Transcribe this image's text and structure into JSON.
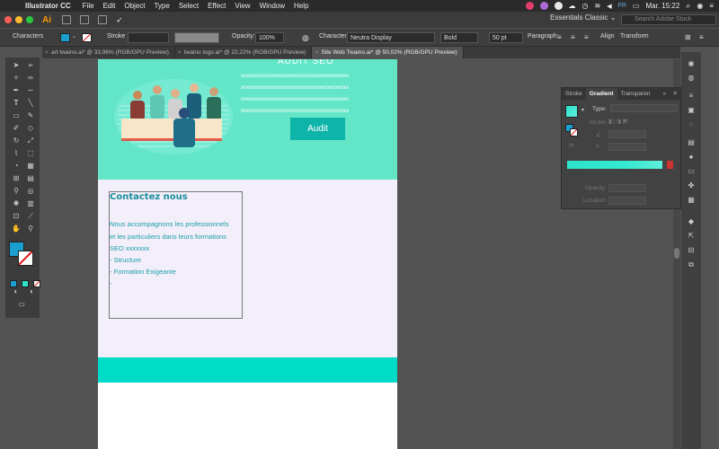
{
  "menubar": {
    "app": "Illustrator CC",
    "items": [
      "File",
      "Edit",
      "Object",
      "Type",
      "Select",
      "Effect",
      "View",
      "Window",
      "Help"
    ],
    "flag": "FR",
    "clock": "Mar. 15:22"
  },
  "appbar": {
    "logo": "Ai",
    "workspace": "Essentials Classic",
    "search_placeholder": "Search Adobe Stock"
  },
  "controlbar": {
    "characters": "Characters",
    "stroke": "Stroke",
    "opacity_label": "Opacity:",
    "opacity_value": "100%",
    "character_label": "Character:",
    "font": "Neutra Display",
    "weight": "Bold",
    "size": "50 pt",
    "paragraph": "Paragraph:",
    "align": "Align",
    "transform": "Transform"
  },
  "tabs": [
    {
      "label": "art twaino.ai* @ 33,96% (RGB/GPU Preview)",
      "active": false
    },
    {
      "label": "twaino logo.ai* @ 22,22% (RGB/GPU Preview)",
      "active": false
    },
    {
      "label": "Site Web Twaino.ai* @ 50,02% (RGB/GPU Preview)",
      "active": true
    }
  ],
  "artboard": {
    "hero_title": "AUDIT SEO",
    "x_lines": [
      "xxxxxxxxxxxxxxxxxxxxxxxxxxxxxxxxxxxxxxxx",
      "xxxxxxxxxxxxxxxxxxxxxxxxxxxxxxxxxxxxxxxx",
      "xxxxxxxxxxxxxxxxxxxxxxxxxxxxxxxxxxxxxxxx",
      "xxxxxxxxxxxxxxxxxxxxxxxxxxxxxxxxxxxxxxxx"
    ],
    "audit_button": "Audit",
    "contact_title": "Contactez nous",
    "body_lines": [
      "Nous accompagnons les professionnels",
      "et les particuliers dans leurs formations",
      "SEO xxxxxxx",
      "- Structure",
      "- Formation Exigeante",
      "-"
    ]
  },
  "gradient_panel": {
    "tabs": [
      "Stroke",
      "Gradient",
      "Transparen"
    ],
    "type_label": "Type:",
    "stroke_label": "Stroke:",
    "opacity_label": "Opacity:",
    "location_label": "Location:"
  },
  "colors": {
    "hero": "#63e6c8",
    "button": "#0fb4a8",
    "band": "#00dcc8",
    "text_teal": "#1a9fa6",
    "lavender": "#f2eefa"
  }
}
